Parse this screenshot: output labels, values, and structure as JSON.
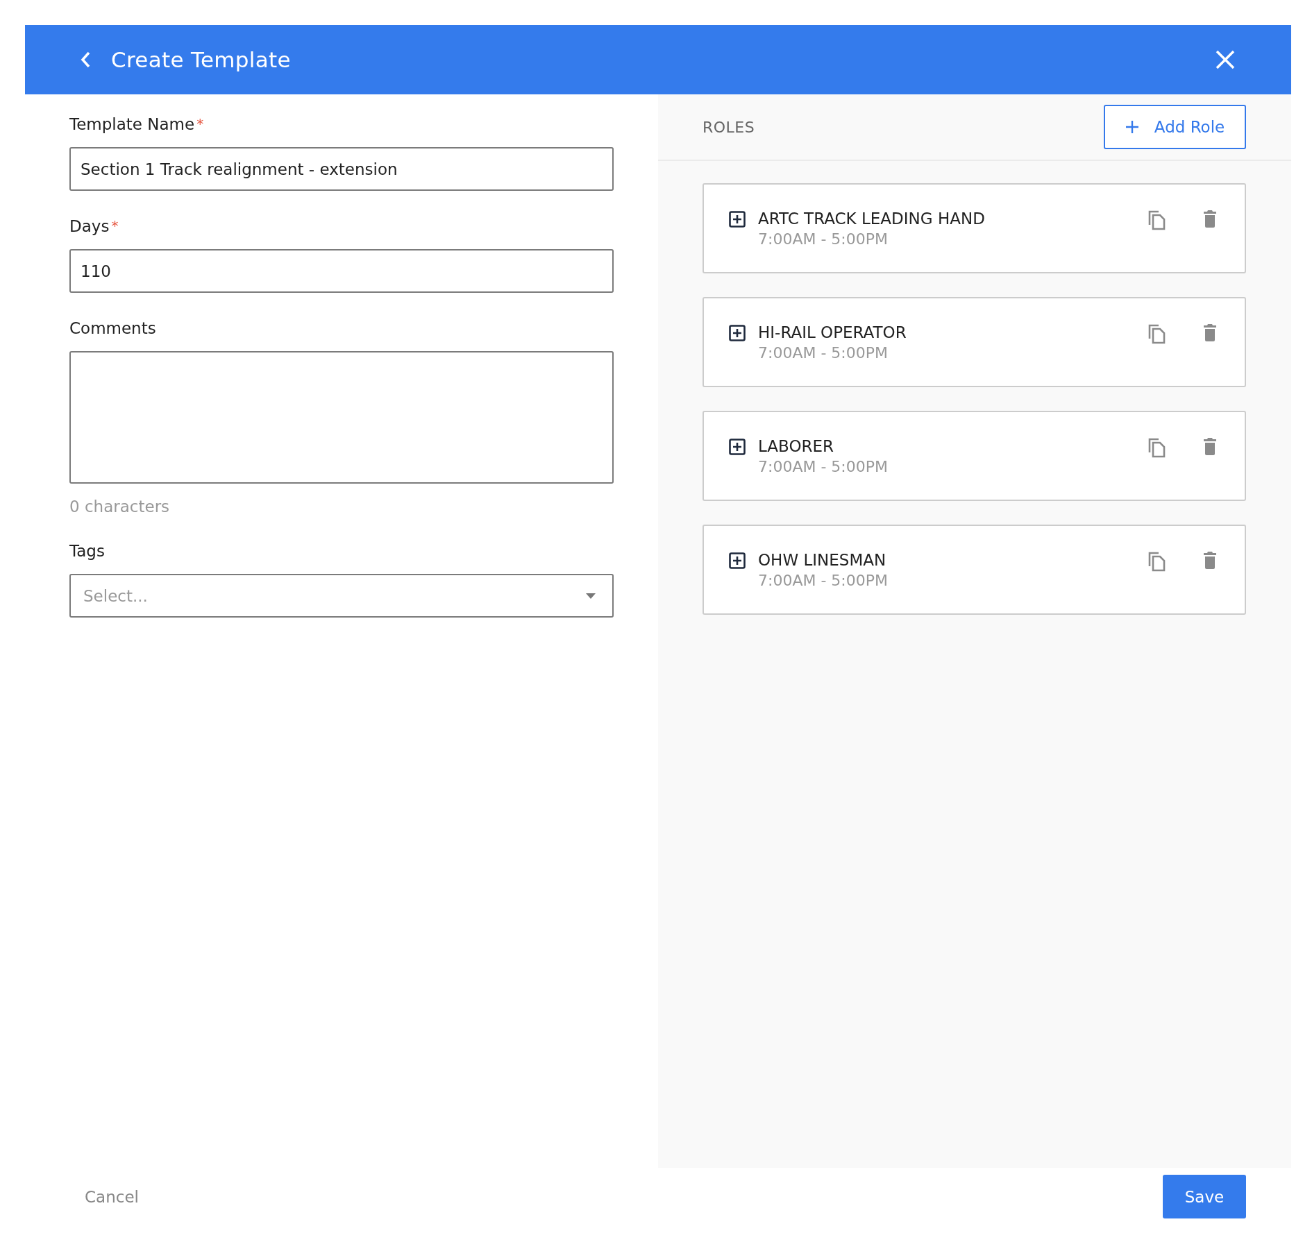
{
  "header": {
    "title": "Create Template"
  },
  "form": {
    "fields": [
      {
        "kind": "text",
        "label": "Template Name",
        "required_mark": "*",
        "value": "Section 1 Track realignment - extension"
      },
      {
        "kind": "text",
        "label": "Days",
        "required_mark": "*",
        "value": "110"
      },
      {
        "kind": "textarea",
        "label": "Comments",
        "helper": "0 characters"
      },
      {
        "kind": "select",
        "label": "Tags",
        "placeholder": "Select..."
      }
    ]
  },
  "roles": {
    "heading": "ROLES",
    "add_button": "Add Role",
    "items": [
      {
        "name": "ARTC TRACK LEADING HAND",
        "hours": "7:00AM - 5:00PM"
      },
      {
        "name": "HI-RAIL OPERATOR",
        "hours": "7:00AM - 5:00PM"
      },
      {
        "name": "LABORER",
        "hours": "7:00AM - 5:00PM"
      },
      {
        "name": "OHW LINESMAN",
        "hours": "7:00AM - 5:00PM"
      }
    ]
  },
  "footer": {
    "cancel": "Cancel",
    "save": "Save"
  }
}
